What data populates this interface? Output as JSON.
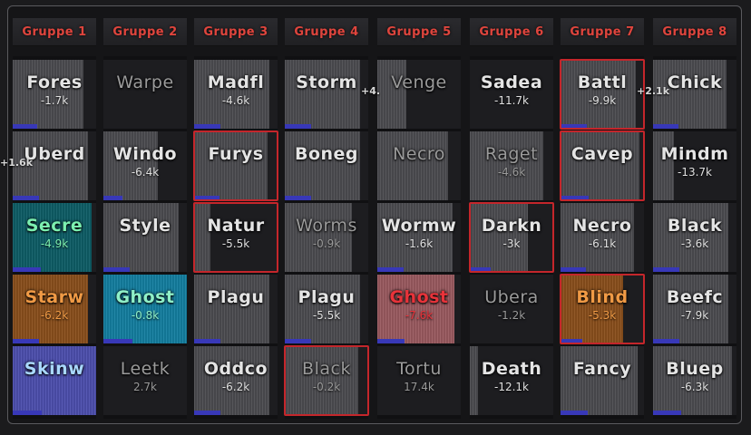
{
  "columns": [
    "Gruppe 1",
    "Gruppe 2",
    "Gruppe 3",
    "Gruppe 4",
    "Gruppe 5",
    "Gruppe 6",
    "Gruppe 7",
    "Gruppe 8"
  ],
  "cells": [
    [
      {
        "name": "Fores",
        "value": "-1.7k"
      },
      {
        "name": "Uberd",
        "value": ""
      },
      {
        "name": "Secre",
        "value": "-4.9k"
      },
      {
        "name": "Starw",
        "value": "-6.2k"
      },
      {
        "name": "Skinw",
        "value": ""
      }
    ],
    [
      {
        "name": "Warpe",
        "value": ""
      },
      {
        "name": "Windo",
        "value": "-6.4k"
      },
      {
        "name": "Style",
        "value": ""
      },
      {
        "name": "Ghost",
        "value": "-0.8k"
      },
      {
        "name": "Leetk",
        "value": "2.7k"
      }
    ],
    [
      {
        "name": "Madfl",
        "value": "-4.6k"
      },
      {
        "name": "Furys",
        "value": ""
      },
      {
        "name": "Natur",
        "value": "-5.5k"
      },
      {
        "name": "Plagu",
        "value": ""
      },
      {
        "name": "Oddco",
        "value": "-6.2k"
      }
    ],
    [
      {
        "name": "Storm",
        "value": ""
      },
      {
        "name": "Boneg",
        "value": ""
      },
      {
        "name": "Worms",
        "value": "-0.9k"
      },
      {
        "name": "Plagu",
        "value": "-5.5k"
      },
      {
        "name": "Black",
        "value": "-0.2k"
      }
    ],
    [
      {
        "name": "Venge",
        "value": ""
      },
      {
        "name": "Necro",
        "value": ""
      },
      {
        "name": "Wormw",
        "value": "-1.6k"
      },
      {
        "name": "Ghost",
        "value": "-7.6k"
      },
      {
        "name": "Tortu",
        "value": "17.4k"
      }
    ],
    [
      {
        "name": "Sadea",
        "value": "-11.7k"
      },
      {
        "name": "Raget",
        "value": "-4.6k"
      },
      {
        "name": "Darkn",
        "value": "-3k"
      },
      {
        "name": "Ubera",
        "value": "-1.2k"
      },
      {
        "name": "Death",
        "value": "-12.1k"
      }
    ],
    [
      {
        "name": "Battl",
        "value": "-9.9k"
      },
      {
        "name": "Cavep",
        "value": ""
      },
      {
        "name": "Necro",
        "value": "-6.1k"
      },
      {
        "name": "Blind",
        "value": "-5.3k"
      },
      {
        "name": "Fancy",
        "value": ""
      }
    ],
    [
      {
        "name": "Chick",
        "value": ""
      },
      {
        "name": "Mindm",
        "value": "-13.7k"
      },
      {
        "name": "Black",
        "value": "-3.6k"
      },
      {
        "name": "Beefc",
        "value": "-7.9k"
      },
      {
        "name": "Bluep",
        "value": "-6.3k"
      }
    ]
  ],
  "fill_fraction": [
    [
      0.85,
      0.9,
      0.95,
      0.9,
      1.0
    ],
    [
      0.0,
      0.65,
      0.9,
      1.0,
      0.0
    ],
    [
      0.9,
      0.88,
      0.2,
      0.9,
      0.9
    ],
    [
      0.9,
      0.9,
      0.8,
      0.9,
      0.88
    ],
    [
      0.35,
      0.85,
      0.9,
      0.92,
      0.0
    ],
    [
      0.0,
      0.88,
      0.7,
      0.0,
      0.1
    ],
    [
      0.9,
      0.95,
      0.88,
      0.75,
      0.92
    ],
    [
      0.88,
      0.25,
      0.9,
      0.9,
      0.95
    ]
  ],
  "highlighted": [
    [
      2,
      1
    ],
    [
      2,
      2
    ],
    [
      3,
      4
    ],
    [
      5,
      2
    ],
    [
      6,
      0
    ],
    [
      6,
      1
    ],
    [
      6,
      3
    ]
  ],
  "floating_labels": [
    {
      "text": "+4.",
      "col": 3,
      "row": 0
    },
    {
      "text": "+2.1k",
      "col": 6,
      "row": 0
    },
    {
      "text": "+1.6k",
      "col": 0,
      "row": 1
    }
  ]
}
